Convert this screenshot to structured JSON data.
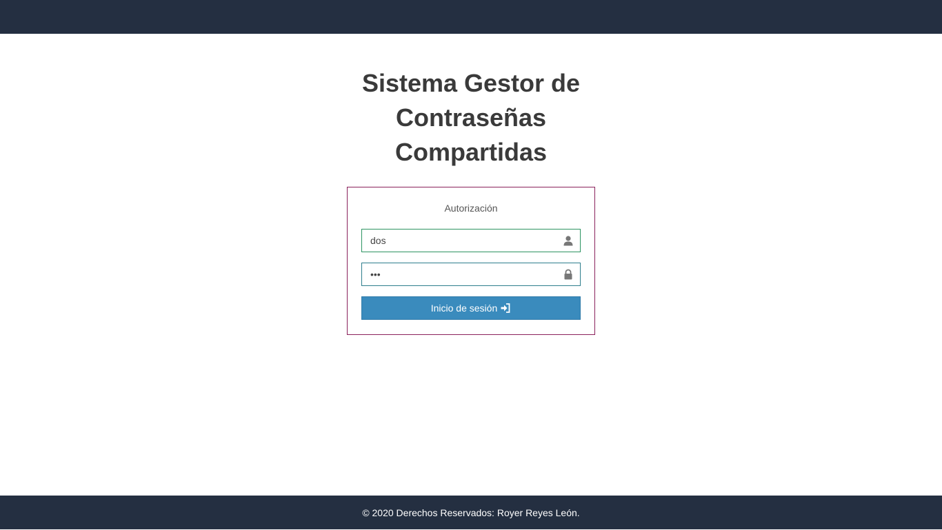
{
  "header": {
    "title_lines": [
      "Sistema Gestor de",
      "Contraseñas",
      "Compartidas"
    ]
  },
  "login": {
    "heading": "Autorización",
    "username": {
      "value": "dos",
      "icon": "user-icon"
    },
    "password": {
      "value": "dos",
      "icon": "lock-icon"
    },
    "submit_label": "Inicio de sesión",
    "submit_icon": "sign-in-icon"
  },
  "footer": {
    "text": "© 2020 Derechos Reservados: Royer Reyes León."
  },
  "colors": {
    "bar": "#242f41",
    "card_border": "#8a1f5a",
    "button": "#3a8bbd",
    "user_border": "#2b9361"
  }
}
